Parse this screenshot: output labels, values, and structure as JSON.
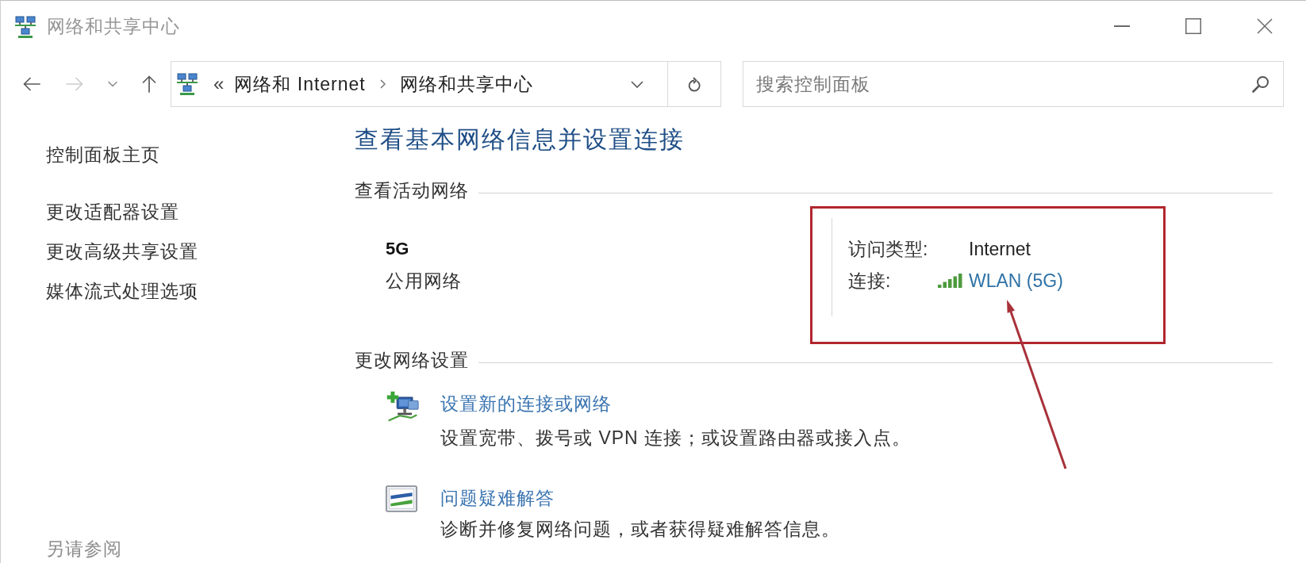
{
  "window": {
    "title": "网络和共享中心"
  },
  "navigation": [
    {
      "kind": "back",
      "disabled": false
    },
    {
      "kind": "forward",
      "disabled": true
    },
    {
      "kind": "recent",
      "disabled": false
    },
    {
      "kind": "up",
      "disabled": false
    }
  ],
  "address_bar": {
    "overflow": "«",
    "path": [
      "网络和 Internet",
      "网络和共享中心"
    ]
  },
  "search": {
    "placeholder": "搜索控制面板"
  },
  "sidebar": {
    "items": [
      "控制面板主页",
      "更改适配器设置",
      "更改高级共享设置",
      "媒体流式处理选项"
    ],
    "see_also": "另请参阅"
  },
  "main": {
    "title": "查看基本网络信息并设置连接",
    "active_networks": {
      "heading": "查看活动网络",
      "network": {
        "name": "5G",
        "category": "公用网络"
      },
      "properties": [
        {
          "kind": "text",
          "label": "访问类型:",
          "value": "Internet"
        },
        {
          "kind": "link",
          "label": "连接:",
          "value": "WLAN (5G)"
        }
      ]
    },
    "change_settings": {
      "heading": "更改网络设置",
      "tasks": [
        {
          "kind": "new_connection",
          "link": "设置新的连接或网络",
          "description": "设置宽带、拨号或 VPN 连接；或设置路由器或接入点。"
        },
        {
          "kind": "troubleshoot",
          "link": "问题疑难解答",
          "description": "诊断并修复网络问题，或者获得疑难解答信息。"
        }
      ]
    }
  },
  "annotations": [
    {
      "kind": "highlight_box"
    },
    {
      "kind": "arrow"
    }
  ]
}
